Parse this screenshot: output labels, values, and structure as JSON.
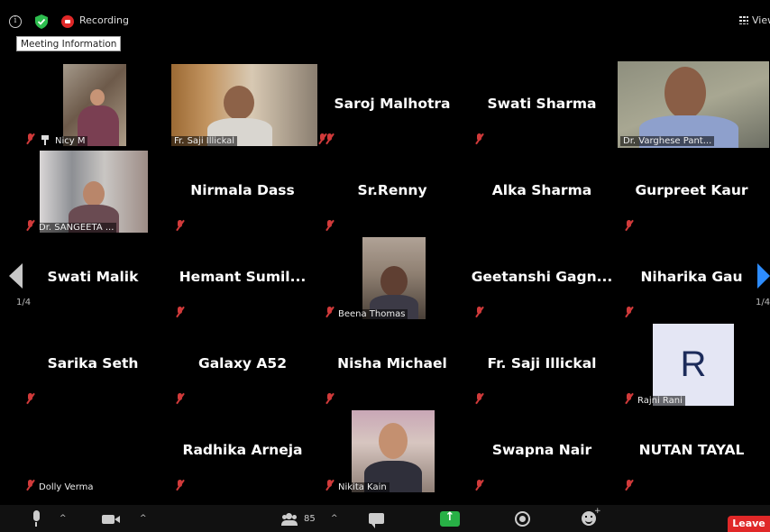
{
  "topbar": {
    "recording_label": "Recording",
    "tooltip": "Meeting Information",
    "view_label": "View"
  },
  "pagination": {
    "left": "1/4",
    "right": "1/4"
  },
  "tiles": [
    {
      "type": "video",
      "label": "Nicy M"
    },
    {
      "type": "video",
      "label": "Fr. Saji Illickal"
    },
    {
      "type": "name",
      "name": "Saroj Malhotra"
    },
    {
      "type": "name",
      "name": "Swati Sharma"
    },
    {
      "type": "video",
      "label": "Dr. Varghese Pant..."
    },
    {
      "type": "video",
      "label": "Dr. SANGEETA ..."
    },
    {
      "type": "name",
      "name": "Nirmala Dass"
    },
    {
      "type": "name",
      "name": "Sr.Renny"
    },
    {
      "type": "name",
      "name": "Alka Sharma"
    },
    {
      "type": "name",
      "name": "Gurpreet Kaur"
    },
    {
      "type": "name",
      "name": "Swati Malik"
    },
    {
      "type": "name",
      "name": "Hemant Sumil..."
    },
    {
      "type": "video",
      "label": "Beena Thomas"
    },
    {
      "type": "name",
      "name": "Geetanshi  Gagn..."
    },
    {
      "type": "name",
      "name": "Niharika Gau"
    },
    {
      "type": "name",
      "name": "Sarika Seth"
    },
    {
      "type": "name",
      "name": "Galaxy A52"
    },
    {
      "type": "name",
      "name": "Nisha Michael"
    },
    {
      "type": "name",
      "name": "Fr. Saji Illickal"
    },
    {
      "type": "avatar",
      "letter": "R",
      "label": "Rajni Rani"
    },
    {
      "type": "label",
      "label": "Dolly Verma"
    },
    {
      "type": "name",
      "name": "Radhika Arneja"
    },
    {
      "type": "video",
      "label": "Nikita Kain"
    },
    {
      "type": "name",
      "name": "Swapna Nair"
    },
    {
      "type": "name",
      "name": "NUTAN TAYAL"
    }
  ],
  "toolbar": {
    "participants_count": "85",
    "leave_label": "Leave"
  },
  "colors": {
    "background": "#000000",
    "active_speaker": "#b8e03c",
    "muted_icon": "#d13a3a",
    "share_green": "#28b046",
    "leave_red": "#e02828",
    "nav_blue": "#2d8cff"
  }
}
